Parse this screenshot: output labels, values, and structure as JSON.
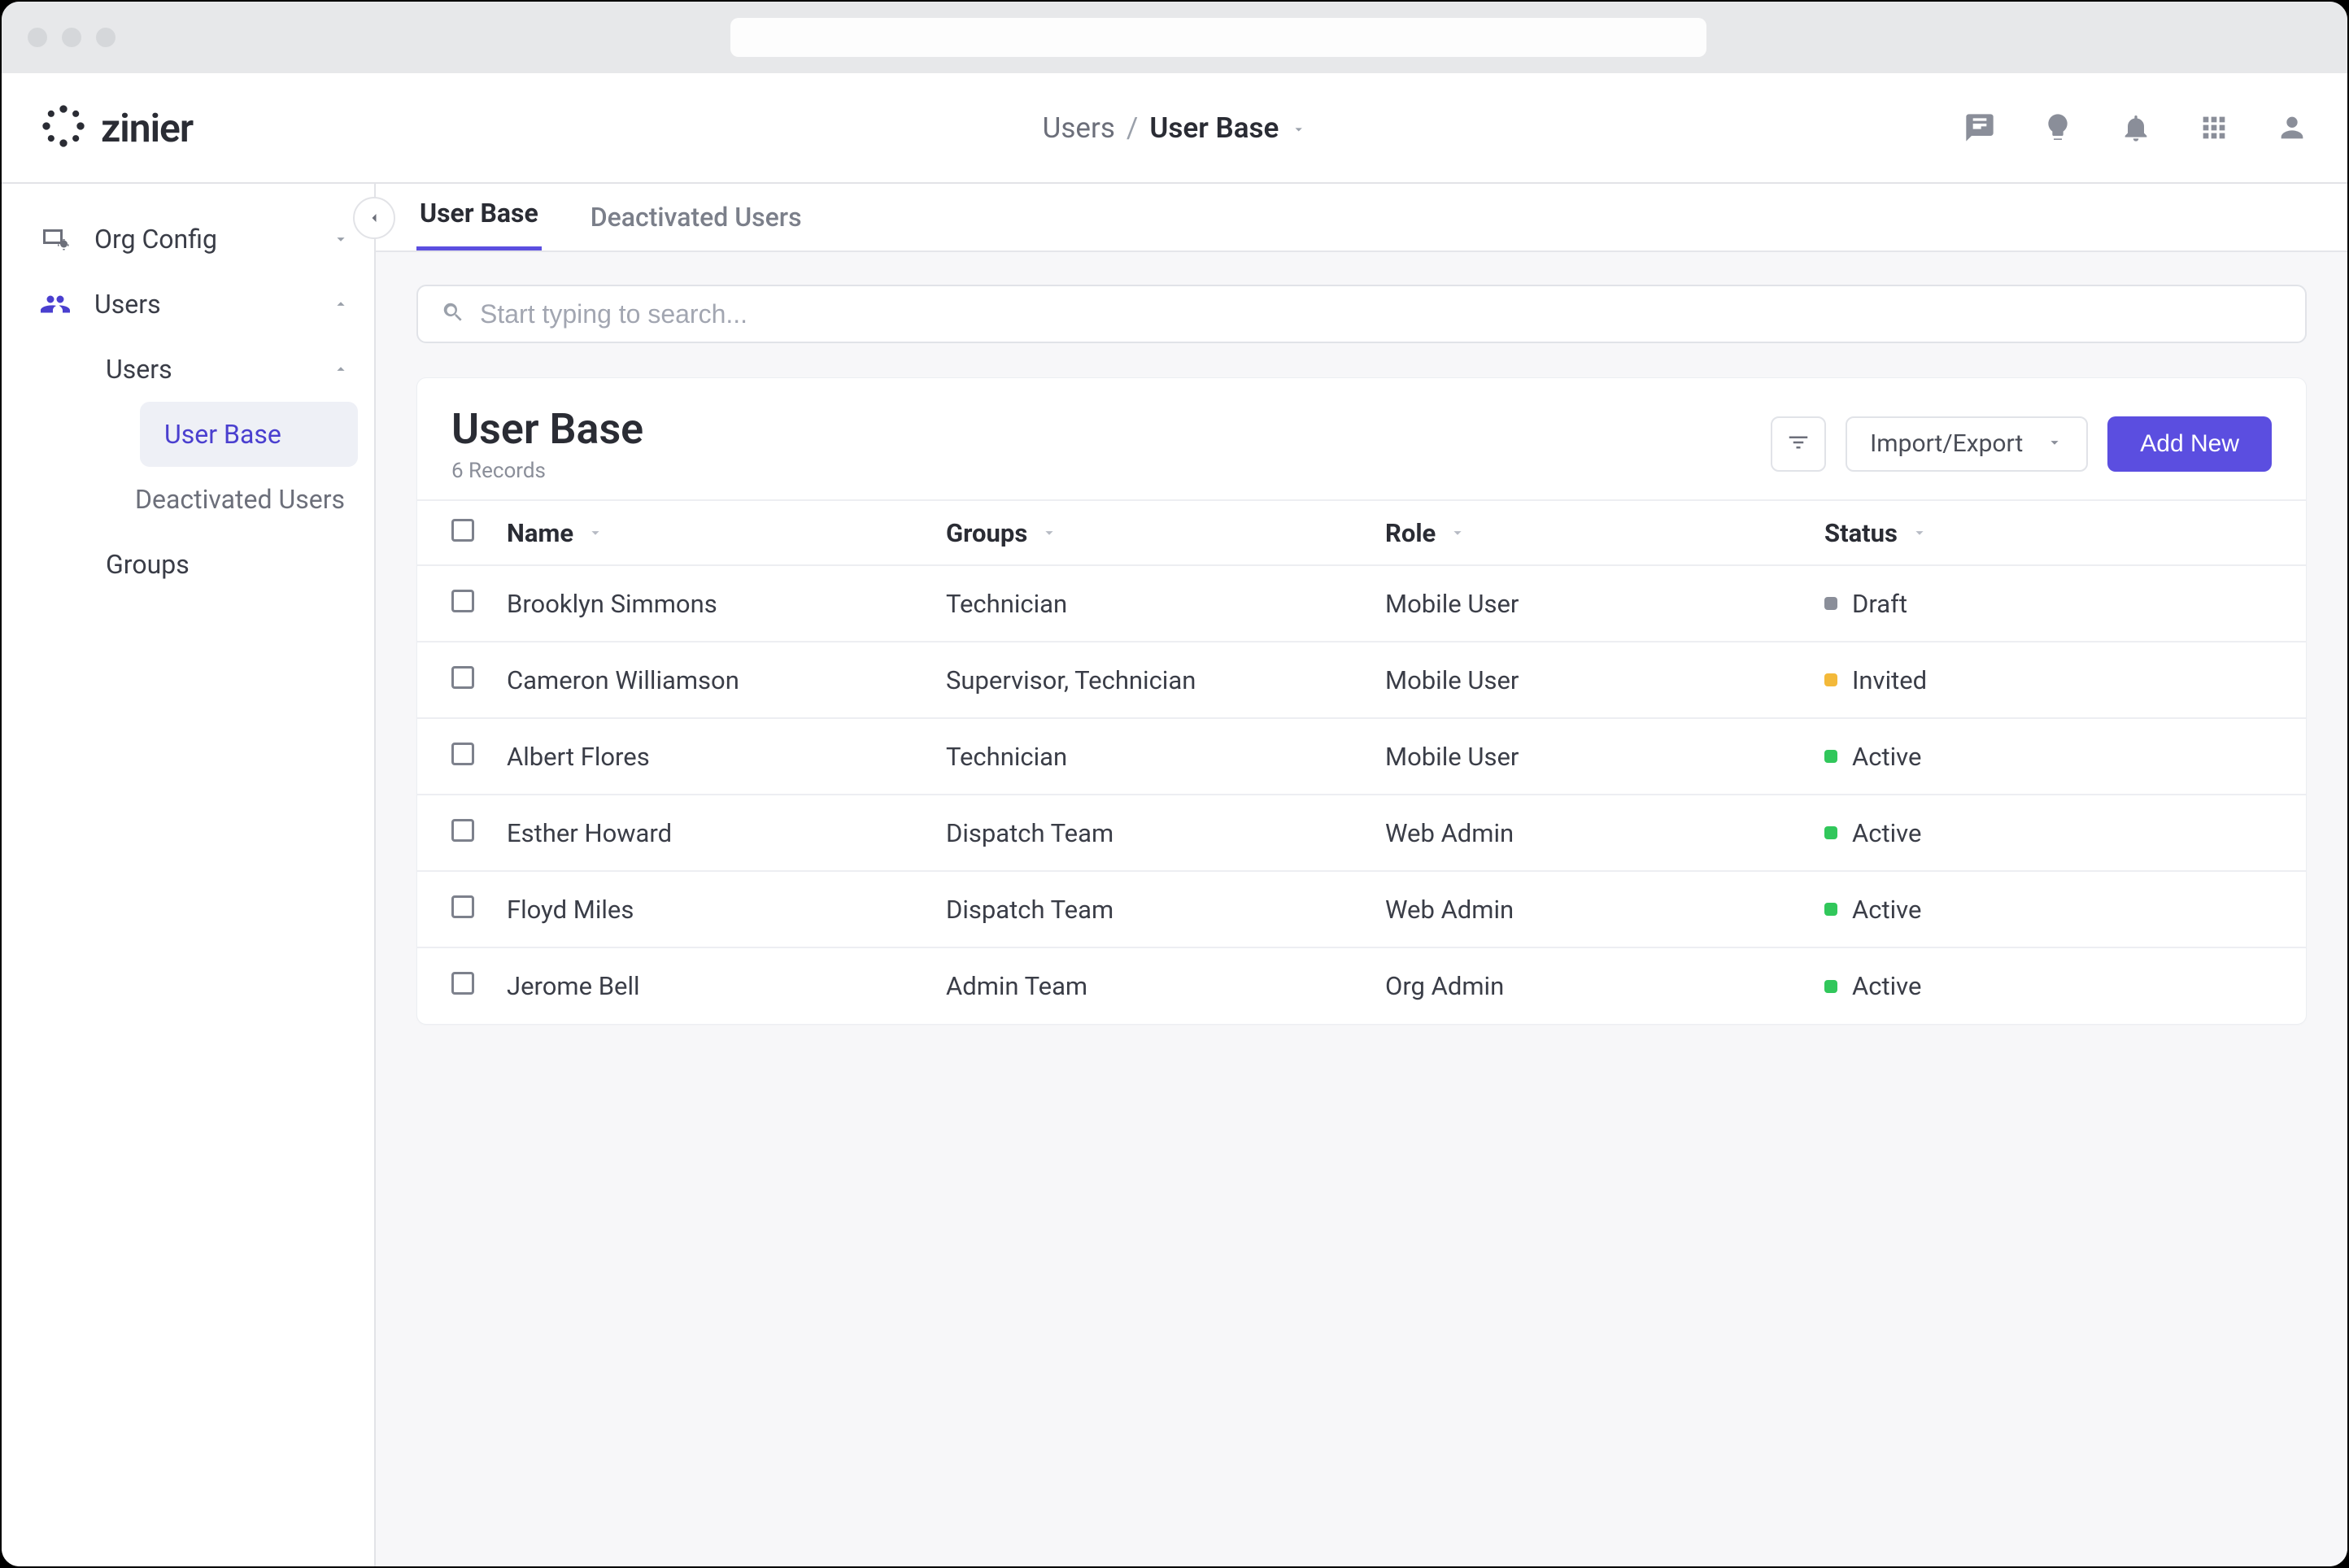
{
  "brand": {
    "name": "zinier"
  },
  "breadcrumb": {
    "parent": "Users",
    "sep": "/",
    "current": "User Base"
  },
  "sidebar": {
    "items": [
      {
        "label": "Org Config"
      },
      {
        "label": "Users"
      },
      {
        "label": "Users"
      },
      {
        "label": "User Base"
      },
      {
        "label": "Deactivated Users"
      },
      {
        "label": "Groups"
      }
    ]
  },
  "tabs": [
    {
      "label": "User Base",
      "active": true
    },
    {
      "label": "Deactivated Users",
      "active": false
    }
  ],
  "search": {
    "placeholder": "Start typing to search..."
  },
  "panel": {
    "title": "User Base",
    "subtitle": "6 Records",
    "import_export_label": "Import/Export",
    "add_new_label": "Add New"
  },
  "table": {
    "columns": [
      "Name",
      "Groups",
      "Role",
      "Status"
    ],
    "rows": [
      {
        "name": "Brooklyn Simmons",
        "groups": "Technician",
        "role": "Mobile User",
        "status": "Draft",
        "status_kind": "draft"
      },
      {
        "name": "Cameron Williamson",
        "groups": "Supervisor, Technician",
        "role": "Mobile User",
        "status": "Invited",
        "status_kind": "invited"
      },
      {
        "name": "Albert Flores",
        "groups": "Technician",
        "role": "Mobile User",
        "status": "Active",
        "status_kind": "active"
      },
      {
        "name": "Esther Howard",
        "groups": "Dispatch Team",
        "role": "Web Admin",
        "status": "Active",
        "status_kind": "active"
      },
      {
        "name": "Floyd Miles",
        "groups": "Dispatch Team",
        "role": "Web Admin",
        "status": "Active",
        "status_kind": "active"
      },
      {
        "name": "Jerome Bell",
        "groups": "Admin Team",
        "role": "Org Admin",
        "status": "Active",
        "status_kind": "active"
      }
    ]
  }
}
